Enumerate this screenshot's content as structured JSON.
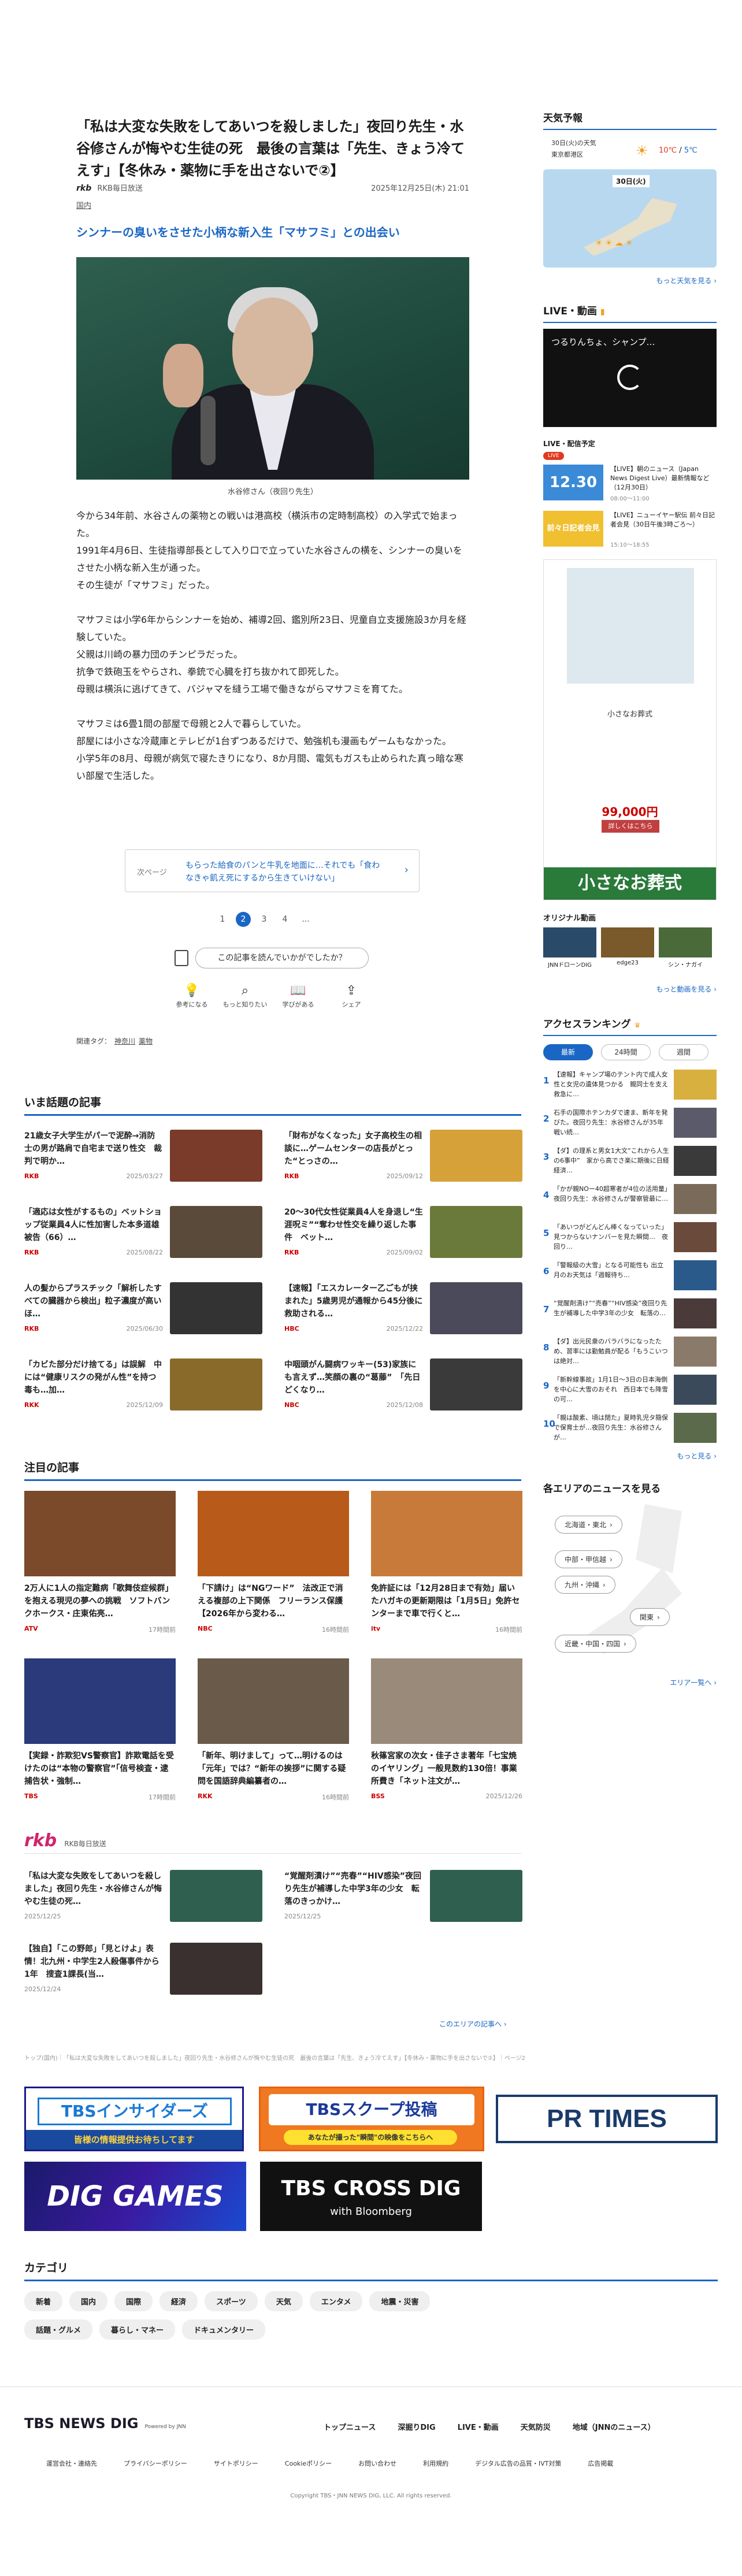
{
  "article": {
    "title": "「私は大変な失敗をしてあいつを殺しました」夜回り先生・水谷修さんが悔やむ生徒の死　最後の言葉は「先生、きょう冷てえす」【冬休み・薬物に手を出さないで②】",
    "source_name": "RKB毎日放送",
    "source_logo": "rkb",
    "published": "2025年12月25日(木) 21:01",
    "category": "国内",
    "subheading": "シンナーの臭いをさせた小柄な新入生「マサフミ」との出会い",
    "photo_caption": "水谷修さん（夜回り先生）",
    "paragraphs": [
      "今から34年前、水谷さんの薬物との戦いは港高校（横浜市の定時制高校）の入学式で始まった。",
      "1991年4月6日、生徒指導部長として入り口で立っていた水谷さんの横を、シンナーの臭いをさせた小柄な新入生が通った。",
      "その生徒が「マサフミ」だった。",
      "",
      "マサフミは小学6年からシンナーを始め、補導2回、鑑別所23日、児童自立支援施設3か月を経験していた。",
      "父親は川崎の暴力団のチンピラだった。",
      "抗争で鉄砲玉をやらされ、拳銃で心臓を打ち抜かれて即死した。",
      "母親は横浜に逃げてきて、バジャマを縫う工場で働きながらマサフミを育てた。",
      "",
      "マサフミは6畳1間の部屋で母親と2人で暮らしていた。",
      "部屋には小さな冷蔵庫とテレビが1台ずつあるだけで、勉強机も漫画もゲームもなかった。",
      "小学5年の8月、母親が病気で寝たきりになり、8か月間、電気もガスも止められた真っ暗な寒い部屋で生活した。"
    ],
    "next_label": "次ページ",
    "next_text": "もらった給食のパンと牛乳を地面に…それでも「食わなきゃ飢え死にするから生きていけない」",
    "pages": [
      "1",
      "2",
      "3",
      "4",
      "..."
    ],
    "current_page": "2",
    "help_question": "この記事を読んでいかがでしたか？",
    "reactions": [
      {
        "icon": "lightbulb-icon",
        "glyph": "💡",
        "label": "参考になる"
      },
      {
        "icon": "search-icon",
        "glyph": "⌕",
        "label": "もっと知りたい"
      },
      {
        "icon": "book-icon",
        "glyph": "📖",
        "label": "学びがある"
      },
      {
        "icon": "share-icon",
        "glyph": "⇪",
        "label": "シェア"
      }
    ],
    "tags_label": "関連タグ：",
    "tags": [
      "神奈川",
      "薬物"
    ]
  },
  "hot_topics": {
    "heading": "いま話題の記事",
    "items": [
      {
        "title": "21歳女子大学生がパーで泥酔→消防士の男が路肩で自宅まで送り性交　裁判で明か…",
        "src": "RKB",
        "date": "2025/03/27",
        "thumb": "#7a3b2b"
      },
      {
        "title": "「財布がなくなった」女子高校生の相談に…ゲームセンターの店長がとった“とっさの…",
        "src": "RKB",
        "date": "2025/09/12",
        "thumb": "#d7a13a"
      },
      {
        "title": "「適応は女性がするもの」ベットショップ従業員4人に性加害した本多道雄被告（66）…",
        "src": "RKB",
        "date": "2025/08/22",
        "thumb": "#5a4a3a"
      },
      {
        "title": "20〜30代女性従業員4人を身退し“生涯呪ミ”“奪わせ性交を繰り返した事件　ベット…",
        "src": "RKB",
        "date": "2025/09/02",
        "thumb": "#6a7a3a"
      },
      {
        "title": "人の髪からプラスチック「解析したすべての臓器から検出」粒子濃度が高いほ…",
        "src": "RKB",
        "date": "2025/06/30",
        "thumb": "#333333"
      },
      {
        "title": "【速報】「エスカレーター乙ごもが挟まれた」5歳男児が通報から45分後に救助される…",
        "src": "HBC",
        "date": "2025/12/22",
        "thumb": "#4a4a5a"
      },
      {
        "title": "「カビた部分だけ捨てる」は誤解　中には“健康リスクの発がん性”を持つ毒も…加…",
        "src": "RKK",
        "date": "2025/12/09",
        "thumb": "#8a6a2a"
      },
      {
        "title": "中咽頭がん闘病ワッキー(53)家族にも言えず…笑顔の裏の“葛藤”　「先日どくなり…",
        "src": "NBC",
        "date": "2025/12/08",
        "thumb": "#3a3a3a"
      }
    ]
  },
  "featured": {
    "heading": "注目の記事",
    "items": [
      {
        "title": "2万人に1人の指定難病「歌舞伎症候群」を抱える現児の夢への挑戦　ソフトバンクホークス・庄東佑亮…",
        "src": "ATV",
        "date": "17時間前",
        "thumb": "#7a4a2a"
      },
      {
        "title": "「下請け」は“NGワード”　法改正で消える複部の上下関係　フリーランス保護【2026年から変わる…",
        "src": "NBC",
        "date": "16時間前",
        "thumb": "#b85a1a"
      },
      {
        "title": "免許証には「12月28日まで有効」届いたハガキの更新期限は「1月5日」免許センターまで車で行くと…",
        "src": "itv",
        "date": "16時間前",
        "thumb": "#c87a3a"
      },
      {
        "title": "【実録・詐欺犯VS警察官】詐欺電話を受けたのは“本物の警察官”「信号検査・逮捕告状・強制…",
        "src": "TBS",
        "date": "17時間前",
        "thumb": "#2a3a7a"
      },
      {
        "title": "「新年、明けまして」って…明けるのは「元年」では？“新年の挨拶”に関する疑問を国語辞典編纂者の…",
        "src": "RKK",
        "date": "16時間前",
        "thumb": "#6a5a4a"
      },
      {
        "title": "秋篠宮家の次女・佳子さま著年「七宝焼のイヤリング」一般見数約130倍！事業所費き「ネット注文が…",
        "src": "BSS",
        "date": "2025/12/26",
        "thumb": "#9a8a7a"
      }
    ]
  },
  "rkb_section": {
    "logo": "rkb",
    "label": "RKB毎日放送",
    "items": [
      {
        "title": "「私は大変な失敗をしてあいつを殺しました」夜回り先生・水谷修さんが悔やむ生徒の死…",
        "date": "2025/12/25",
        "thumb": "#2f5f4f"
      },
      {
        "title": "“覚醒剤漬け”“売春”“HIV感染”夜回り先生が補導した中学3年の少女　転落のきっかけ…",
        "date": "2025/12/25",
        "thumb": "#2f5f4f"
      },
      {
        "title": "【独自】「この野郎」「見とけよ」表情！北九州・中学生2人殺傷事件から1年　搜査1課長(当…",
        "date": "2025/12/24",
        "thumb": "#3a3030"
      }
    ],
    "more": "このエリアの記事へ ›"
  },
  "breadcrumb": "トップ(国内)｜「私は大変な失敗をしてあいつを殺しました」夜回り先生・水谷修さんが悔やむ生徒の死　最後の言葉は「先生、きょう冷てえす」【冬休み・薬物に手を出さないで②】｜ページ2",
  "banners": [
    {
      "name": "tbs-insiders-banner",
      "line1": "TBSインサイダーズ",
      "line2": "皆様の情報提供お待ちしてます"
    },
    {
      "name": "tbs-scoop-banner",
      "line1": "TBSスクープ投稿",
      "line2": "あなたが撮った\"瞬間\"の映像をこちらへ"
    },
    {
      "name": "prtimes-banner",
      "line1": "PR TIMES",
      "line2": ""
    },
    {
      "name": "dig-games-banner",
      "line1": "DIG GAMES",
      "line2": ""
    },
    {
      "name": "tbs-crossdig-banner",
      "line1": "TBS CROSS DIG",
      "line2": "with Bloomberg"
    }
  ],
  "categories": {
    "heading": "カテゴリ",
    "items": [
      "新着",
      "国内",
      "国際",
      "経済",
      "スポーツ",
      "天気",
      "エンタメ",
      "地震・災害",
      "話題・グルメ",
      "暮らし・マネー",
      "ドキュメンタリー"
    ]
  },
  "footer": {
    "logo": "TBS NEWS DIG",
    "logo_sub": "Powered by JNN",
    "nav": [
      "トップニュース",
      "深掘りDIG",
      "LIVE・動画",
      "天気防災",
      "地域（JNNのニュース）"
    ],
    "links": [
      "運営会社・連絡先",
      "プライバシーポリシー",
      "サイトポリシー",
      "Cookieポリシー",
      "お問い合わせ",
      "利用規約",
      "デジタル広告の品質・IVT対策",
      "広告掲載"
    ],
    "copyright": "Copyright TBS・JNN NEWS DIG, LLC. All rights reserved."
  },
  "sidebar": {
    "weather": {
      "heading": "天気予報",
      "date": "30日(火)の天気",
      "region": "東京都港区",
      "temp_high": "10℃",
      "temp_low": "5℃",
      "map_title": "30日(火)",
      "more": "もっと天気を見る ›"
    },
    "live": {
      "heading": "LIVE・動画",
      "video_title": "つるりんちょ、シャンプ…",
      "schedule_heading": "LIVE・配信予定",
      "badge": "LIVE",
      "schedule": [
        {
          "title": "【LIVE】朝のニュース（Japan News Digest Live）最新情報など（12月30日）",
          "time": "08:00〜11:00",
          "thumb_text": "12.30"
        },
        {
          "title": "【LIVE】ニューイヤー駅伝 前々日記者会見（30日午後3時ごろ〜）",
          "time": "15:10〜18:55",
          "thumb_text": "前々日記者会見"
        }
      ]
    },
    "ad": {
      "shop": "小さなお葬式",
      "price": "99,000円",
      "cta": "詳しくはこちら",
      "banner": "小さなお葬式"
    },
    "original": {
      "heading": "オリジナル動画",
      "items": [
        "JNNドローンDIG",
        "edge23",
        "シン・ナガイ"
      ],
      "more": "もっと動画を見る ›"
    },
    "ranking": {
      "heading": "アクセスランキング",
      "tabs": [
        "最新",
        "24時間",
        "週間"
      ],
      "items": [
        {
          "n": "1",
          "title": "【速報】キャンプ場のテント内で成人女性と女児の遺体見つかる　親同士を支え救急に…"
        },
        {
          "n": "2",
          "title": "石手の国際ホテンカダで速ま、新年を発びた。夜回り先生：水谷修さんが35年戦い続…"
        },
        {
          "n": "3",
          "title": "【ダ】の理系と男女1大文“これから人生の6事中”　家から高でさ楽に期後に日経経済…"
        },
        {
          "n": "4",
          "title": "「かが親NOー40超寒者が4位の活用量」夜回り先生：水谷修さんが警察管最に…"
        },
        {
          "n": "5",
          "title": "「あいつがどんどん棒くなっていった」見つからないナンバーを見た瞬間…　夜回り…"
        },
        {
          "n": "6",
          "title": "「警報級の大雪」となる可能性も 出立月のお天気は「週報待ち…"
        },
        {
          "n": "7",
          "title": "“覚醒剤漬け”“売春”“HIV感染”夜回り先生が補導した中学3年の少女　転落の…"
        },
        {
          "n": "8",
          "title": "【ダ】出元民衆のバラバラになったため、習率には勤勉員が配る「もうこいつは絶対…"
        },
        {
          "n": "9",
          "title": "「新幹線事故」1月1日〜3日の日本海側を中心に大雪のおそれ　西日本でも降雪の可…"
        },
        {
          "n": "10",
          "title": "「親は酸素、頃は閉た」夏時乳児タ簡保で保育士が…夜回り先生：水谷修さんが…"
        }
      ],
      "more": "もっと見る ›"
    },
    "area": {
      "heading": "各エリアのニュースを見る",
      "regions": [
        "北海道・東北",
        "中部・甲信越",
        "九州・沖縄",
        "関東",
        "近畿・中国・四国"
      ],
      "more": "エリア一覧へ ›"
    }
  },
  "colors": {
    "accent": "#1a66c4",
    "live_red": "#e03a1e",
    "rank_new": "#1a66c4"
  }
}
